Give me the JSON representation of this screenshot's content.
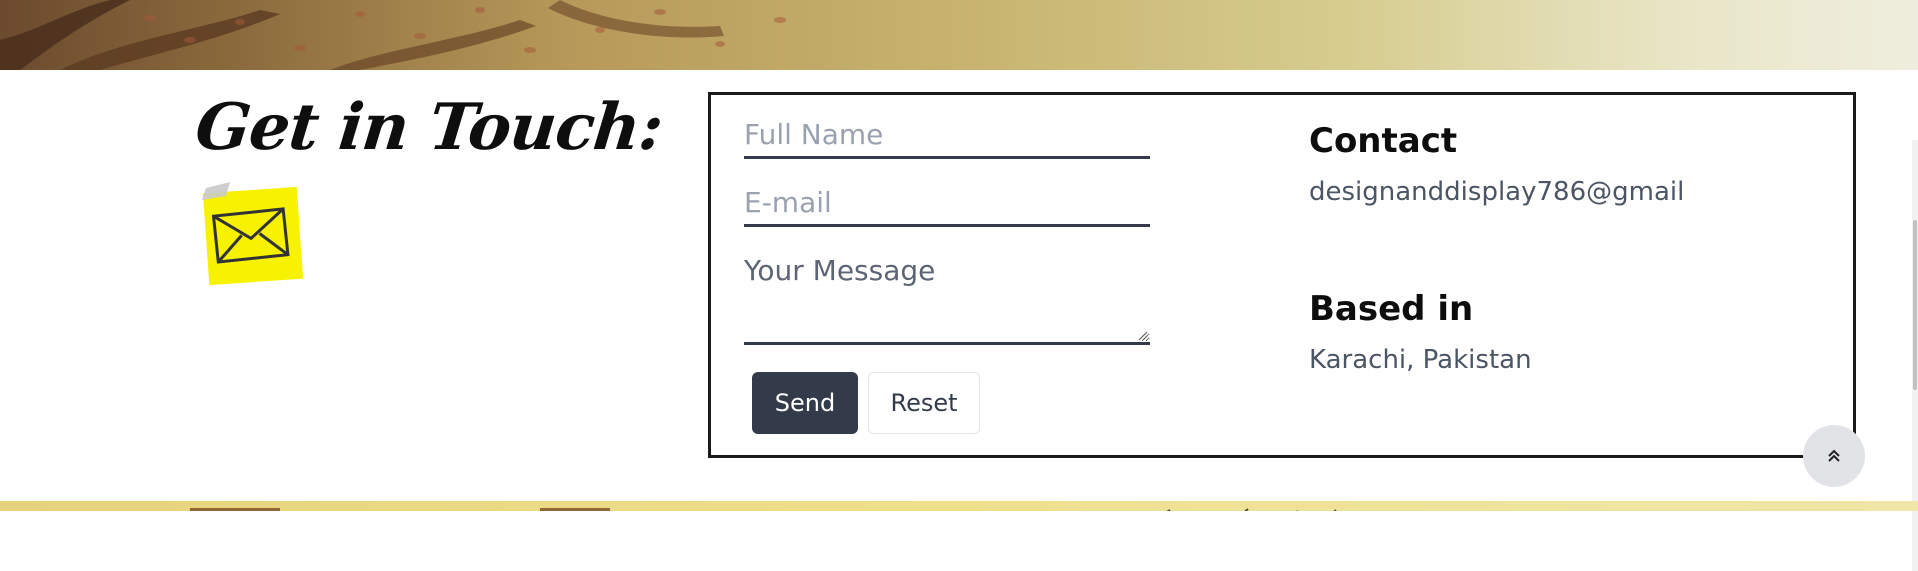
{
  "section": {
    "title": "Get in Touch:"
  },
  "form": {
    "name_placeholder": "Full Name",
    "email_placeholder": "E-mail",
    "message_placeholder": "Your Message",
    "send_label": "Send",
    "reset_label": "Reset"
  },
  "info": {
    "contact_heading": "Contact",
    "contact_value": "designanddisplay786@gmail",
    "based_heading": "Based in",
    "based_value": "Karachi, Pakistan"
  },
  "icons": {
    "sticky_note": "envelope-sticky-note-icon",
    "scroll_top": "double-chevron-up-icon"
  },
  "colors": {
    "button_dark": "#333b4b",
    "note_yellow": "#f7f200",
    "field_underline": "#333b4b"
  }
}
